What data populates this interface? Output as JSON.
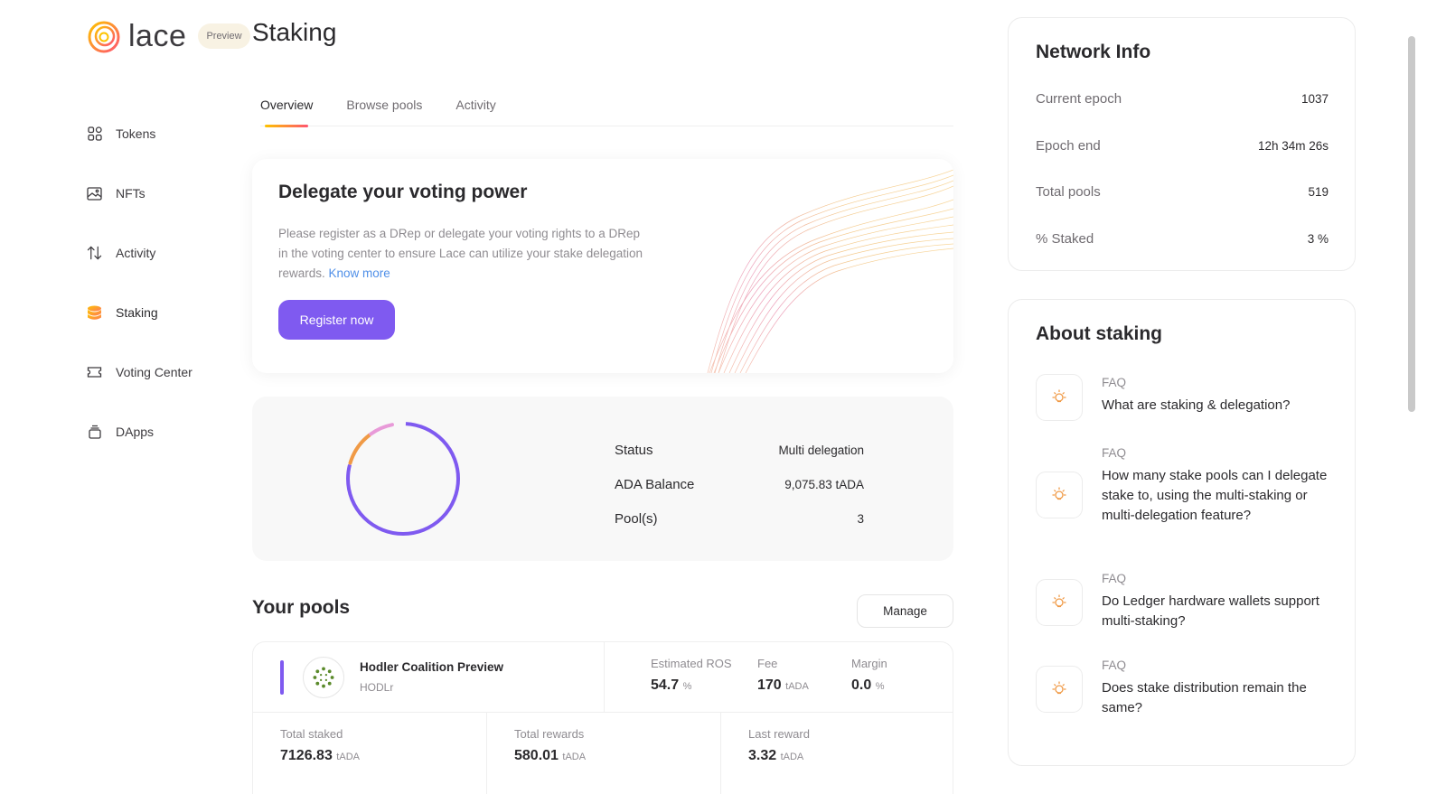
{
  "app": {
    "name": "lace",
    "badge": "Preview",
    "page_title": "Staking"
  },
  "sidebar": {
    "items": [
      {
        "label": "Tokens",
        "icon": "grid-icon"
      },
      {
        "label": "NFTs",
        "icon": "image-icon"
      },
      {
        "label": "Activity",
        "icon": "arrows-up-down-icon"
      },
      {
        "label": "Staking",
        "icon": "coins-stack-icon",
        "active": true
      },
      {
        "label": "Voting Center",
        "icon": "ticket-icon"
      },
      {
        "label": "DApps",
        "icon": "dapps-icon"
      }
    ]
  },
  "tabs": [
    {
      "label": "Overview",
      "active": true
    },
    {
      "label": "Browse pools"
    },
    {
      "label": "Activity"
    }
  ],
  "delegate": {
    "title": "Delegate your voting power",
    "text": "Please register as a DRep or delegate your voting rights to a DRep in the voting center to ensure Lace can utilize your stake delegation rewards.",
    "link": "Know more",
    "button": "Register now"
  },
  "status": {
    "rows": [
      {
        "label": "Status",
        "value": "Multi delegation"
      },
      {
        "label": "ADA Balance",
        "value": "9,075.83 tADA"
      },
      {
        "label": "Pool(s)",
        "value": "3"
      }
    ]
  },
  "pools": {
    "title": "Your pools",
    "manage": "Manage",
    "pool": {
      "name": "Hodler Coalition Preview",
      "ticker": "HODLr",
      "metrics": [
        {
          "label": "Estimated ROS",
          "value": "54.7",
          "unit": "%"
        },
        {
          "label": "Fee",
          "value": "170",
          "unit": "tADA"
        },
        {
          "label": "Margin",
          "value": "0.0",
          "unit": "%"
        }
      ],
      "totals": [
        {
          "label": "Total staked",
          "value": "7126.83",
          "unit": "tADA"
        },
        {
          "label": "Total rewards",
          "value": "580.01",
          "unit": "tADA"
        },
        {
          "label": "Last reward",
          "value": "3.32",
          "unit": "tADA"
        }
      ]
    }
  },
  "network": {
    "title": "Network Info",
    "rows": [
      {
        "label": "Current epoch",
        "value": "1037"
      },
      {
        "label": "Epoch end",
        "value": "12h 34m 26s"
      },
      {
        "label": "Total pools",
        "value": "519"
      },
      {
        "label": "% Staked",
        "value": "3 %"
      }
    ]
  },
  "about": {
    "title": "About staking",
    "faqs": [
      {
        "tag": "FAQ",
        "question": "What are staking & delegation?"
      },
      {
        "tag": "FAQ",
        "question": "How many stake pools can I delegate stake to, using the multi-staking or multi-delegation feature?"
      },
      {
        "tag": "FAQ",
        "question": "Do Ledger hardware wallets support multi-staking?"
      },
      {
        "tag": "FAQ",
        "question": "Does stake distribution remain the same?"
      }
    ]
  },
  "colors": {
    "accent": "#7f5af0",
    "link": "#4f8fe8",
    "orange": "#f09a46",
    "pink": "#e89ad8"
  }
}
